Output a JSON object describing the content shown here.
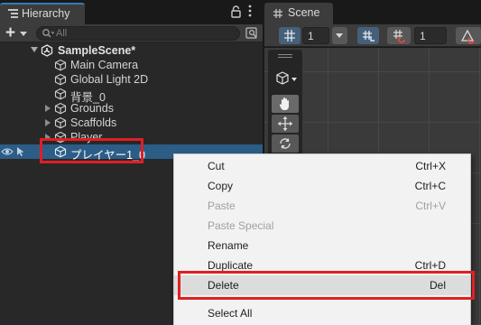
{
  "hierarchy": {
    "tab_label": "Hierarchy",
    "search_placeholder": "All",
    "scene": {
      "label": "SampleScene*"
    },
    "items": [
      {
        "label": "Main Camera"
      },
      {
        "label": "Global Light 2D"
      },
      {
        "label": "背景_0"
      },
      {
        "label": "Grounds"
      },
      {
        "label": "Scaffolds"
      },
      {
        "label": "Player"
      },
      {
        "label": "プレイヤー1_0"
      }
    ]
  },
  "scene_view": {
    "tab_label": "Scene",
    "grid_size": "1",
    "increment_snap": "1"
  },
  "context_menu": {
    "items": [
      {
        "label": "Cut",
        "shortcut": "Ctrl+X"
      },
      {
        "label": "Copy",
        "shortcut": "Ctrl+C"
      },
      {
        "label": "Paste",
        "shortcut": "Ctrl+V"
      },
      {
        "label": "Paste Special",
        "shortcut": ""
      },
      {
        "label": "Rename",
        "shortcut": ""
      },
      {
        "label": "Duplicate",
        "shortcut": "Ctrl+D"
      },
      {
        "label": "Delete",
        "shortcut": "Del"
      },
      {
        "label": "Select All",
        "shortcut": ""
      }
    ]
  },
  "colors": {
    "selection": "#2c5d87",
    "annotation_highlight": "#e01f23",
    "tab_accent": "#3a79bb"
  },
  "icons": [
    "list-icon",
    "lock-icon",
    "more-icon",
    "plus-icon",
    "search-icon",
    "filter-icon",
    "unity-scene-icon",
    "gameobject-cube-icon",
    "eye-icon",
    "pick-icon",
    "grid-icon",
    "snap-icon",
    "increment-snap-icon",
    "rotate-snap-icon",
    "hand-tool-icon",
    "move-tool-icon",
    "rotate-tool-icon"
  ]
}
